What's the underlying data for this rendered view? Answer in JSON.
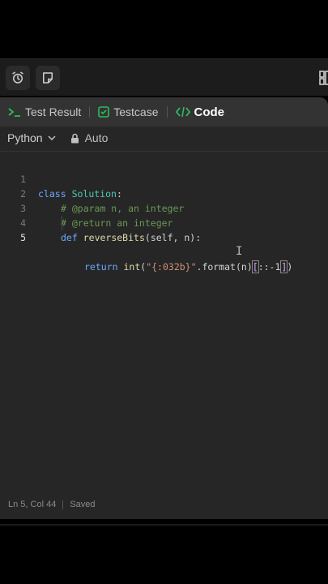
{
  "toolbar": {
    "left_buttons": [
      {
        "icon": "alarm-clock-icon"
      },
      {
        "icon": "note-icon"
      }
    ],
    "right_icon": "layout-icon"
  },
  "tabs": [
    {
      "label": "Test Result",
      "icon": "terminal-icon",
      "active": false
    },
    {
      "label": "Testcase",
      "icon": "checkbox-icon",
      "active": false
    },
    {
      "label": "Code",
      "icon": "code-icon",
      "active": true
    }
  ],
  "editor_bar": {
    "language": "Python",
    "mode": "Auto"
  },
  "code": {
    "line_numbers": [
      "1",
      "2",
      "3",
      "4",
      "5"
    ],
    "line1": {
      "kw": "class",
      "name": "Solution",
      "colon": ":"
    },
    "line2": {
      "comment": "# @param n, an integer"
    },
    "line3": {
      "comment": "# @return an integer"
    },
    "line4": {
      "kw": "def",
      "fn": "reverseBits",
      "params": "(self, n):"
    },
    "line5": {
      "kw": "return",
      "fn": "int",
      "open": "(",
      "str": "\"{:032b}\"",
      "mid": ".format(n)",
      "slice_open": "[",
      "slice": "::-1",
      "slice_close": "]",
      "close": ")"
    }
  },
  "status": {
    "position": "Ln 5, Col 44",
    "state": "Saved"
  },
  "colors": {
    "accent_green": "#2cbb5d",
    "keyword": "#6ea8fe",
    "comment": "#6a9955",
    "string": "#ce9178"
  }
}
